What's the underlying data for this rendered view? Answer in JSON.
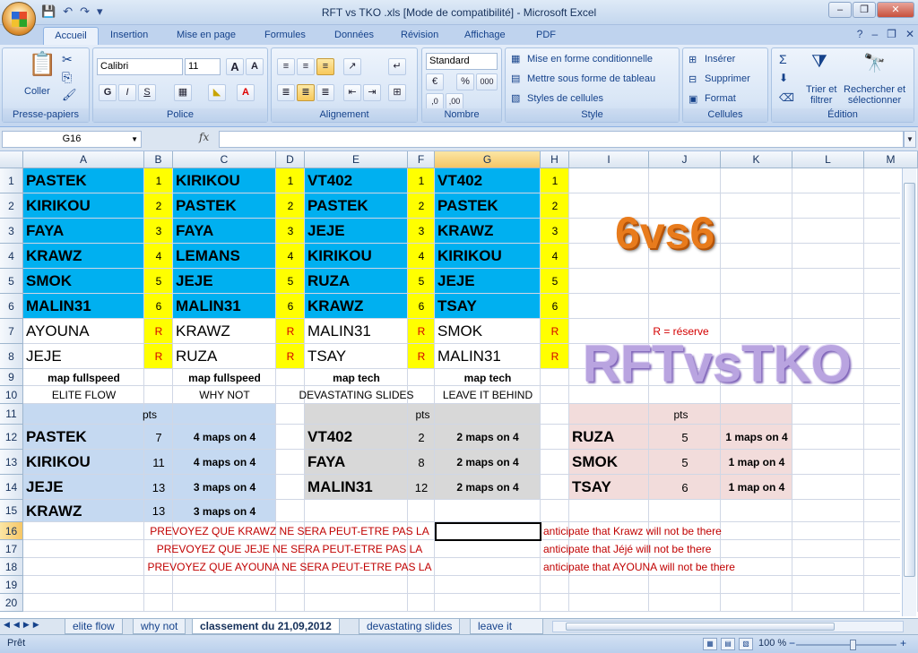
{
  "window": {
    "title": "RFT vs TKO .xls  [Mode de compatibilité] - Microsoft Excel"
  },
  "qat": {
    "save": "💾",
    "undo": "↶",
    "redo": "↷",
    "more": "▾"
  },
  "wincontrols": {
    "min": "–",
    "restore": "❐",
    "close": "✕"
  },
  "help": {
    "help": "?",
    "min": "–",
    "restore": "❐",
    "close": "✕"
  },
  "tabs": [
    "Accueil",
    "Insertion",
    "Mise en page",
    "Formules",
    "Données",
    "Révision",
    "Affichage",
    "PDF"
  ],
  "ribbon": {
    "clipboard": {
      "label": "Presse-papiers",
      "paste": "Coller",
      "paste_icon": "📋",
      "cut_icon": "✂",
      "copy_icon": "⎘",
      "brush_icon": "🖌"
    },
    "font": {
      "label": "Police",
      "name": "Calibri",
      "size": "11",
      "grow": "A",
      "shrink": "A",
      "bold": "G",
      "italic": "I",
      "underline": "S"
    },
    "alignment": {
      "label": "Alignement"
    },
    "number": {
      "label": "Nombre",
      "format": "Standard",
      "percent": "%",
      "thousands": "000",
      "inc": ",0",
      "dec": ",00"
    },
    "style": {
      "label": "Style",
      "cond": "Mise en forme conditionnelle",
      "table": "Mettre sous forme de tableau",
      "cell": "Styles de cellules"
    },
    "cells": {
      "label": "Cellules",
      "insert": "Insérer",
      "delete": "Supprimer",
      "format": "Format"
    },
    "editing": {
      "label": "Édition",
      "sum": "Σ",
      "sort": "Trier et filtrer",
      "sort_line1": "Trier et",
      "sort_line2": "filtrer",
      "find_line1": "Rechercher et",
      "find_line2": "sélectionner"
    }
  },
  "formula_bar": {
    "name_box": "G16",
    "fx": "fx",
    "content": ""
  },
  "columns": [
    "A",
    "B",
    "C",
    "D",
    "E",
    "F",
    "G",
    "H",
    "I",
    "J",
    "K",
    "L",
    "M"
  ],
  "rows": [
    "1",
    "2",
    "3",
    "4",
    "5",
    "6",
    "7",
    "8",
    "9",
    "10",
    "11",
    "12",
    "13",
    "14",
    "15",
    "16",
    "17",
    "18",
    "19",
    "20"
  ],
  "teams": {
    "A": [
      "PASTEK",
      "KIRIKOU",
      "FAYA",
      "KRAWZ",
      "SMOK",
      "MALIN31"
    ],
    "C": [
      "KIRIKOU",
      "PASTEK",
      "FAYA",
      "LEMANS",
      "JEJE",
      "MALIN31"
    ],
    "E": [
      "VT402",
      "PASTEK",
      "JEJE",
      "KIRIKOU",
      "RUZA",
      "KRAWZ"
    ],
    "G": [
      "VT402",
      "PASTEK",
      "KRAWZ",
      "KIRIKOU",
      "JEJE",
      "TSAY"
    ]
  },
  "numbers": [
    "1",
    "2",
    "3",
    "4",
    "5",
    "6"
  ],
  "reserves": {
    "A": [
      "AYOUNA",
      "JEJE"
    ],
    "C": [
      "KRAWZ",
      "RUZA"
    ],
    "E": [
      "MALIN31",
      "TSAY"
    ],
    "G": [
      "SMOK",
      "MALIN31"
    ]
  },
  "reserve_mark": "R",
  "maps": {
    "A": "map fullspeed",
    "C": "map fullspeed",
    "E": "map tech",
    "G": "map tech"
  },
  "songs": {
    "A": "ELITE FLOW",
    "C": "WHY NOT",
    "E": "DEVASTATING SLIDES",
    "G": "LEAVE IT BEHIND"
  },
  "reserve_note": "R = réserve",
  "header_6vs6": "6vs6",
  "header_rftvstko": "RFTvsTKO",
  "pts_label": "pts",
  "standings": {
    "left": [
      {
        "name": "PASTEK",
        "pts": "7",
        "maps": "4 maps on 4"
      },
      {
        "name": "KIRIKOU",
        "pts": "11",
        "maps": "4 maps on 4"
      },
      {
        "name": "JEJE",
        "pts": "13",
        "maps": "3 maps on 4"
      },
      {
        "name": "KRAWZ",
        "pts": "13",
        "maps": "3 maps on 4"
      }
    ],
    "middle": [
      {
        "name": "VT402",
        "pts": "2",
        "maps": "2 maps on 4"
      },
      {
        "name": "FAYA",
        "pts": "8",
        "maps": "2 maps on 4"
      },
      {
        "name": "MALIN31",
        "pts": "12",
        "maps": "2 maps on 4"
      }
    ],
    "right": [
      {
        "name": "RUZA",
        "pts": "5",
        "maps": "1 maps on 4"
      },
      {
        "name": "SMOK",
        "pts": "5",
        "maps": "1 map on 4"
      },
      {
        "name": "TSAY",
        "pts": "6",
        "maps": "1 map on 4"
      }
    ]
  },
  "notes_fr": [
    "PREVOYEZ QUE KRAWZ NE SERA PEUT-ETRE PAS LA",
    "PREVOYEZ QUE JEJE NE SERA PEUT-ETRE PAS LA",
    "PREVOYEZ QUE AYOUNA NE SERA PEUT-ETRE PAS LA"
  ],
  "notes_en": [
    "anticipate that Krawz will not be there",
    "anticipate that Jéjé will not be there",
    "anticipate that AYOUNA will not be there"
  ],
  "sheet_tabs": [
    "elite flow",
    "why not",
    "classement du 21,09,2012",
    "devastating slides",
    "leave it behi"
  ],
  "active_sheet": 2,
  "status": {
    "text": "Prêt",
    "zoom": "100 %",
    "minus": "−",
    "plus": "+"
  },
  "colors": {
    "blue_fill": "#00b0f0",
    "yellow_fill": "#ffff00",
    "light_blue": "#c5d9f1",
    "gray": "#d8d8d8",
    "pink": "#f2dcdb",
    "note_red": "#c00000"
  }
}
